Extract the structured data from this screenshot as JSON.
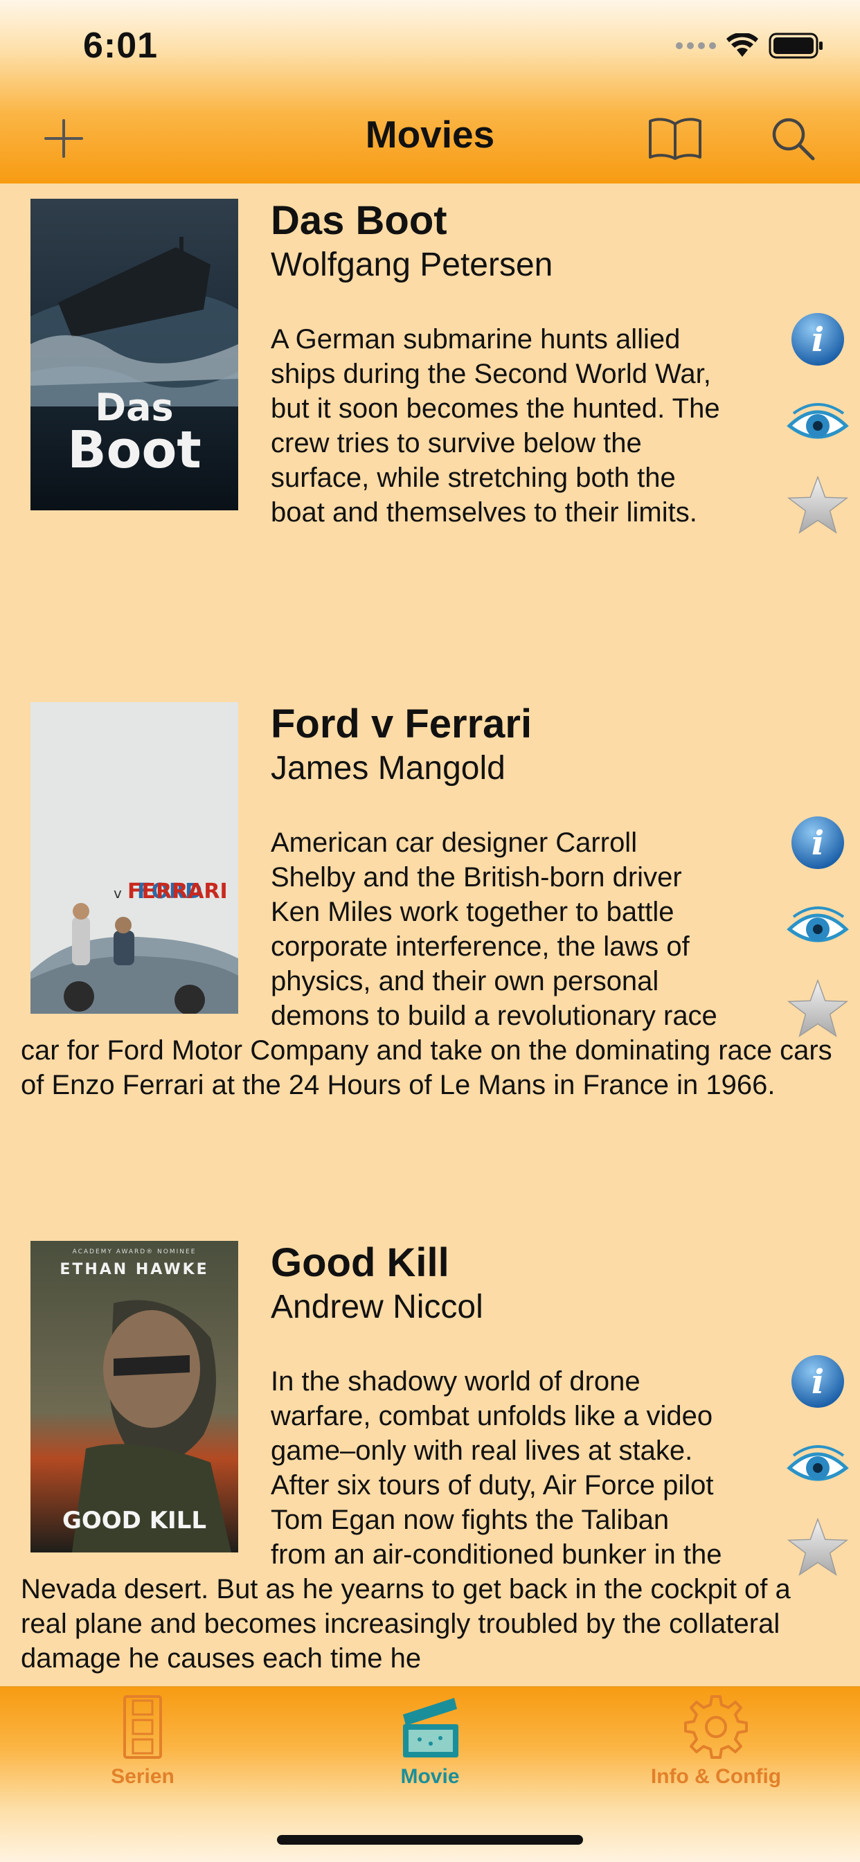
{
  "status_bar": {
    "time": "6:01"
  },
  "nav": {
    "title": "Movies"
  },
  "movies": [
    {
      "title": "Das Boot",
      "director": "Wolfgang Petersen",
      "description": "A German submarine hunts allied ships during the Second World War, but it soon becomes the hunted. The crew tries to survive below the surface, while stretching both the boat and themselves to their limits.",
      "poster_text": [
        "Das",
        "Boot"
      ]
    },
    {
      "title": "Ford v Ferrari",
      "director": "James Mangold",
      "description": "American car designer Carroll Shelby and the British-born driver Ken Miles work together to battle corporate interference, the laws of physics, and their own personal demons to build a revolutionary race car for Ford Motor Company and take on the dominating race cars of Enzo Ferrari at the 24 Hours of Le Mans in France in 1966.",
      "poster_text": [
        "FORD",
        "v",
        "FERRARI"
      ]
    },
    {
      "title": "Good Kill",
      "director": "Andrew Niccol",
      "description": "In the shadowy world of drone warfare, combat unfolds like a video game–only with real lives at stake. After six tours of duty, Air Force pilot Tom Egan now fights the Taliban from an air-conditioned bunker in the Nevada desert. But as he yearns to get back in the cockpit of a real plane and becomes increasingly troubled by the collateral damage he causes each time he",
      "poster_text": [
        "ACADEMY AWARD® NOMINEE",
        "ETHAN HAWKE",
        "GOOD KILL"
      ]
    }
  ],
  "tabs": [
    {
      "label": "Serien",
      "icon": "film-strip-icon",
      "active": false
    },
    {
      "label": "Movie",
      "icon": "clapperboard-icon",
      "active": true
    },
    {
      "label": "Info & Config",
      "icon": "gear-icon",
      "active": false
    }
  ],
  "colors": {
    "background": "#fddba6",
    "header_orange": "#f79b12",
    "tab_active": "#1a8f9a",
    "tab_inactive": "#e2802a"
  }
}
